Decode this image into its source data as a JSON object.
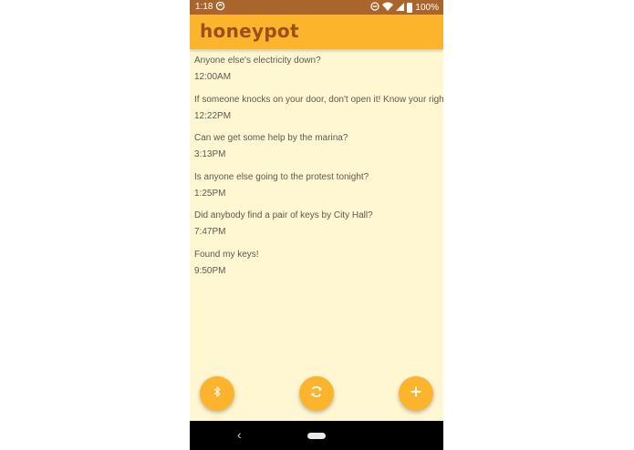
{
  "status_bar": {
    "time": "1:18",
    "battery": "100%"
  },
  "app": {
    "title": "honeypot"
  },
  "posts": [
    {
      "message": "Anyone else's electricity down?",
      "time": "12:00AM"
    },
    {
      "message": "If someone knocks on your door, don't open it! Know your rights!",
      "time": "12:22PM"
    },
    {
      "message": "Can we get some help by the marina?",
      "time": "3:13PM"
    },
    {
      "message": "Is anyone else going to the protest tonight?",
      "time": "1:25PM"
    },
    {
      "message": "Did anybody find a pair of keys by City Hall?",
      "time": "7:47PM"
    },
    {
      "message": "Found my keys!",
      "time": "9:50PM"
    }
  ],
  "fabs": {
    "left_icon": "bluetooth-icon",
    "center_icon": "refresh-icon",
    "right_icon": "plus-icon"
  },
  "colors": {
    "status_bar": "#a9652b",
    "app_bar": "#fbb42c",
    "title": "#9a4f1d",
    "background": "#fff6d2",
    "fab": "#fbb42c"
  }
}
